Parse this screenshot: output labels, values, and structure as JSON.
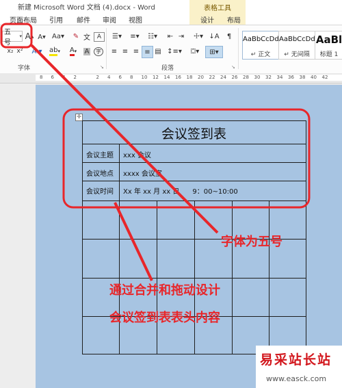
{
  "window": {
    "title": "新建 Microsoft Word 文档 (4).docx - Word",
    "context_tab_group": "表格工具"
  },
  "tabs": [
    "页面布局",
    "引用",
    "邮件",
    "审阅",
    "视图",
    "设计",
    "布局"
  ],
  "ribbon": {
    "font_size_value": "五号",
    "font_group_label": "字体",
    "paragraph_group_label": "段落",
    "grow_font": "A",
    "shrink_font": "A",
    "styles": [
      {
        "sample": "AaBbCcDd",
        "name": "正文"
      },
      {
        "sample": "AaBbCcDd",
        "name": "无间隔"
      },
      {
        "sample": "AaBl",
        "name": "标题 1"
      }
    ]
  },
  "ruler": {
    "numbers": [
      "8",
      "6",
      "4",
      "2",
      "",
      "2",
      "4",
      "6",
      "8",
      "10",
      "12",
      "14",
      "16",
      "18",
      "20",
      "22",
      "24",
      "26",
      "28",
      "30",
      "32",
      "34",
      "36",
      "38",
      "40",
      "42"
    ]
  },
  "document": {
    "table_title": "会议签到表",
    "rows": [
      {
        "label": "会议主题",
        "value": "xxx 会议"
      },
      {
        "label": "会议地点",
        "value": "xxxx 会议室"
      },
      {
        "label": "会议时间",
        "value": "Xx 年 xx 月 xx 日      9：00~10:00"
      }
    ]
  },
  "annotations": {
    "font_note": "字体为五号",
    "design_note_line1": "通过合并和拖动设计",
    "design_note_line2": "会议签到表表头内容",
    "annotation_color": "#e8262a"
  },
  "watermark": {
    "brand": "易采站长站",
    "url": "www.easck.com"
  }
}
